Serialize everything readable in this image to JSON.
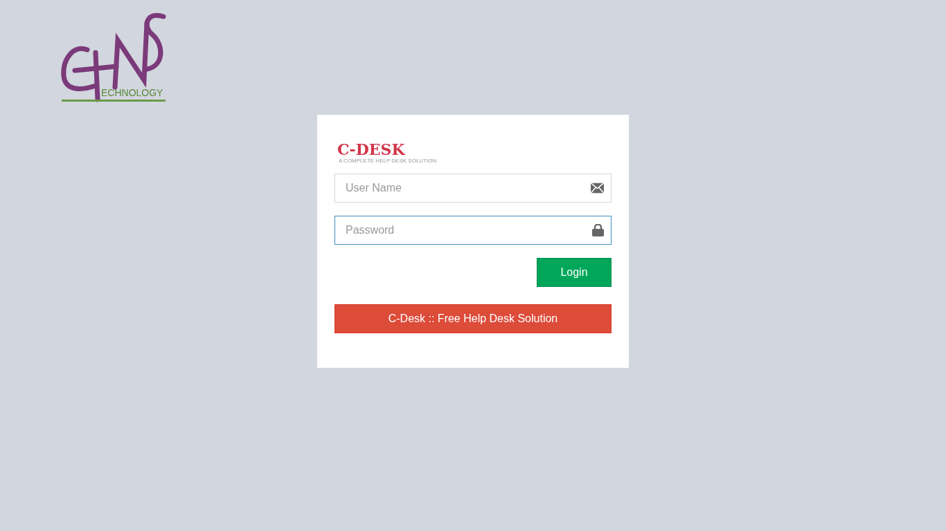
{
  "company_logo": {
    "tagline": "ECHNOLOGY"
  },
  "product_logo": {
    "name": "C-DESK",
    "tagline": "A COMPLETE HELP DESK SOLUTION"
  },
  "fields": [
    {
      "kind": "email",
      "placeholder": "User Name",
      "focused": false
    },
    {
      "kind": "lock",
      "placeholder": "Password",
      "focused": true
    }
  ],
  "login_button": "Login",
  "promo_button": "C-Desk :: Free Help Desk Solution"
}
